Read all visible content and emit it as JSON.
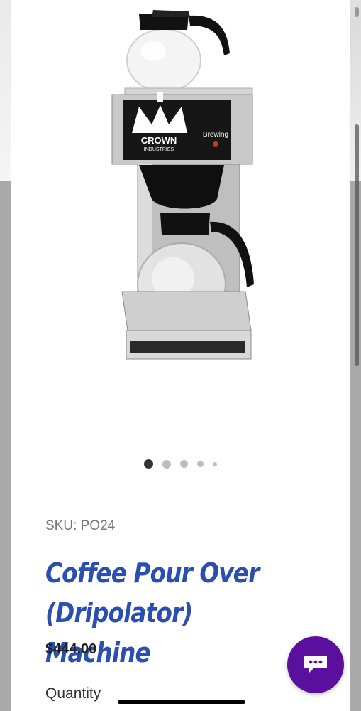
{
  "product": {
    "image_alt": "Coffee pour over machine",
    "brand_text": "CROWN",
    "brand_sub": "INDUSTRIES",
    "status_label": "Brewing",
    "sku": "SKU: PO24",
    "title_line1": "Coffee Pour Over",
    "title_line2": "(Dripolator) Machine",
    "price": "$444.00",
    "quantity_label": "Quantity"
  },
  "carousel": {
    "count": 5,
    "active": 0
  },
  "chat": {
    "icon": "chat-bubble-icon"
  },
  "colors": {
    "title": "#2a4fb0",
    "chat_button": "#5a0f9f"
  }
}
